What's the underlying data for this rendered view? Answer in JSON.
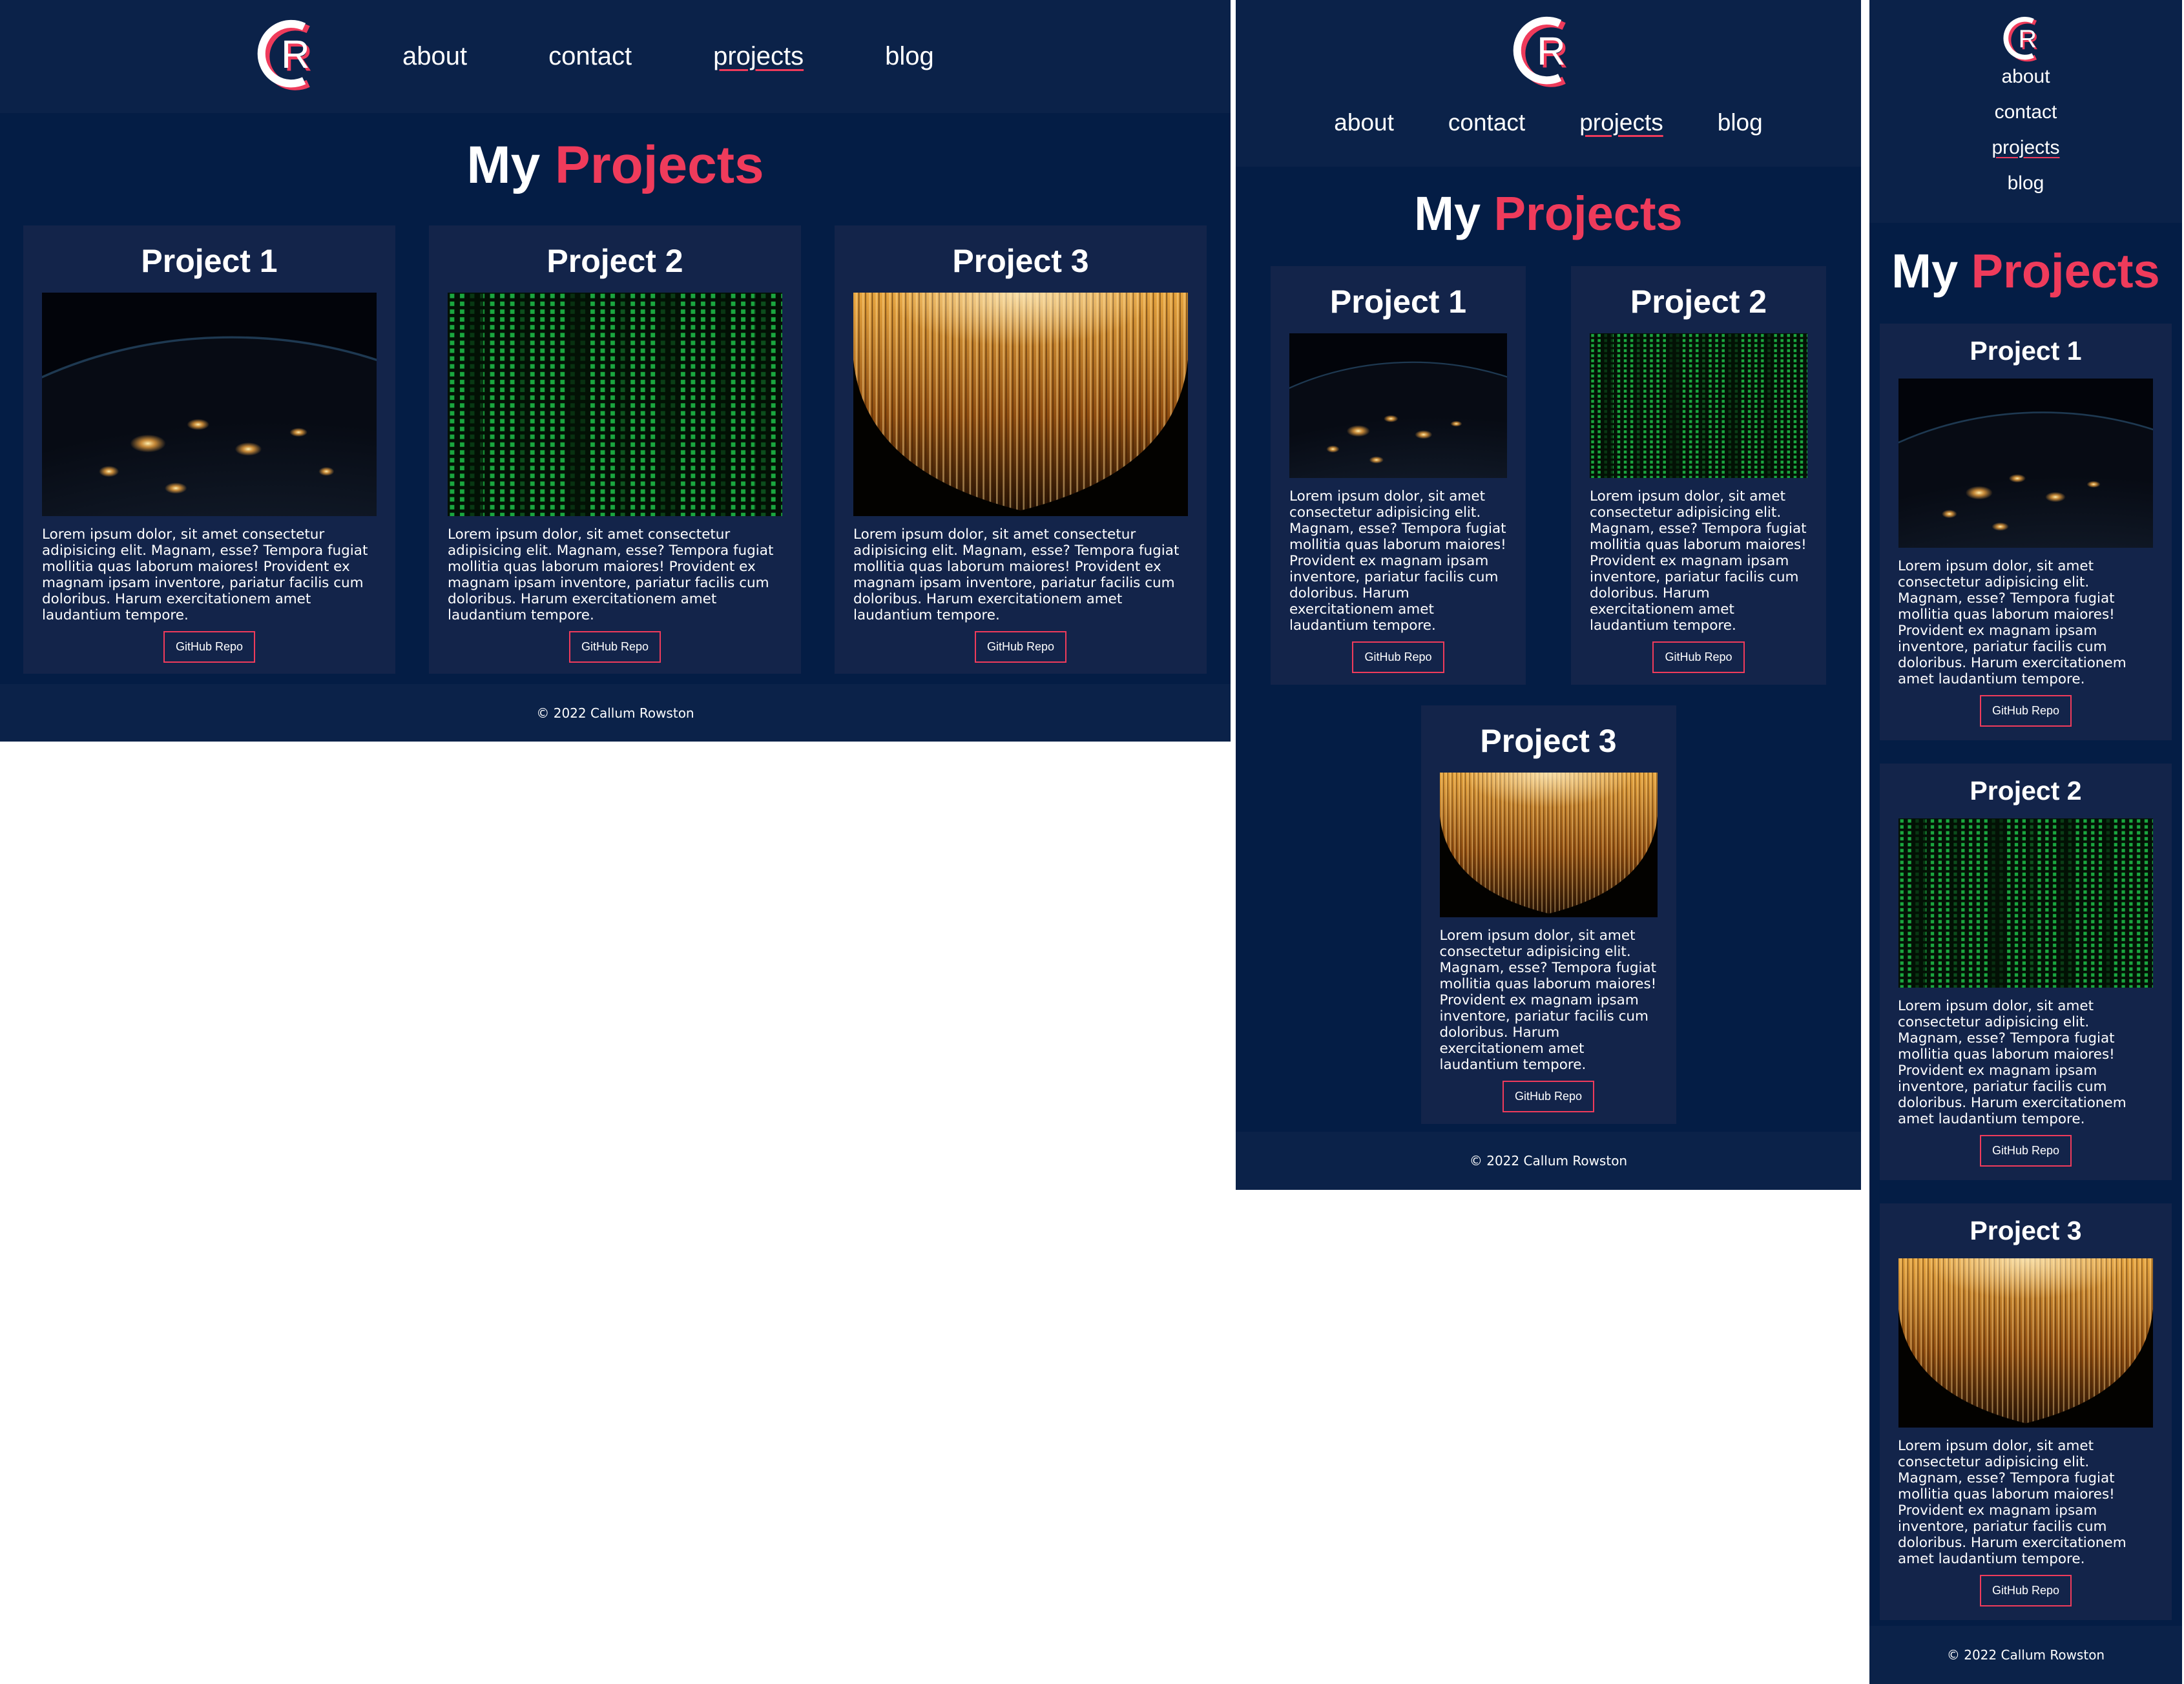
{
  "brand": {
    "logo_letters": "CR",
    "accent_color": "#ef3b5b",
    "nav_background": "#0b2249",
    "page_background": "#041d45",
    "card_background": "#13244a"
  },
  "nav": {
    "items": [
      {
        "label": "about"
      },
      {
        "label": "contact"
      },
      {
        "label": "projects",
        "active": true
      },
      {
        "label": "blog"
      }
    ]
  },
  "page": {
    "title_prefix": "My",
    "title_accent": "Projects"
  },
  "projects": [
    {
      "title": "Project 1",
      "image": "earth-at-night",
      "description": "Lorem ipsum dolor, sit amet consectetur adipisicing elit. Magnam, esse? Tempora fugiat mollitia quas laborum maiores! Provident ex magnam ipsam inventore, pariatur facilis cum doloribus. Harum exercitationem amet laudantium tempore.",
      "button": "GitHub Repo"
    },
    {
      "title": "Project 2",
      "image": "green-code-rain",
      "description": "Lorem ipsum dolor, sit amet consectetur adipisicing elit. Magnam, esse? Tempora fugiat mollitia quas laborum maiores! Provident ex magnam ipsam inventore, pariatur facilis cum doloribus. Harum exercitationem amet laudantium tempore.",
      "button": "GitHub Repo"
    },
    {
      "title": "Project 3",
      "image": "golden-light-streaks",
      "description": "Lorem ipsum dolor, sit amet consectetur adipisicing elit. Magnam, esse? Tempora fugiat mollitia quas laborum maiores! Provident ex magnam ipsam inventore, pariatur facilis cum doloribus. Harum exercitationem amet laudantium tempore.",
      "button": "GitHub Repo"
    }
  ],
  "footer": {
    "text": "© 2022 Callum Rowston"
  }
}
